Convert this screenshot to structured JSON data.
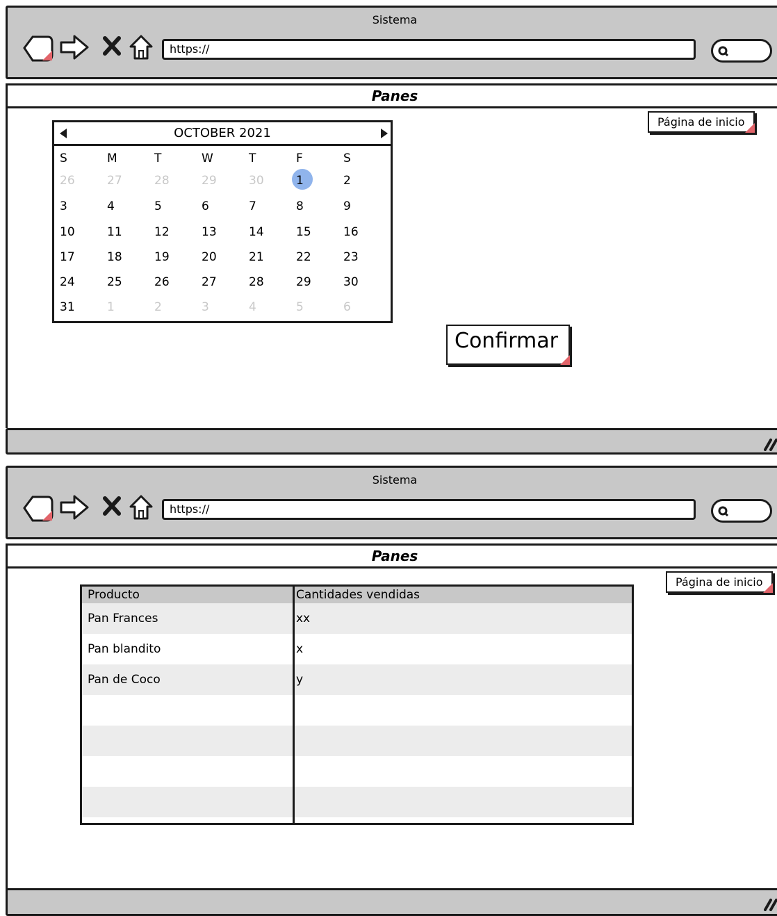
{
  "browser_top": {
    "title": "Sistema",
    "url": "https://",
    "page_title": "Panes",
    "home_button": "Página de inicio"
  },
  "calendar": {
    "month_label": "OCTOBER 2021",
    "weekdays": [
      "S",
      "M",
      "T",
      "W",
      "T",
      "F",
      "S"
    ],
    "weeks": [
      [
        "26",
        "27",
        "28",
        "29",
        "30",
        "1",
        "2"
      ],
      [
        "3",
        "4",
        "5",
        "6",
        "7",
        "8",
        "9"
      ],
      [
        "10",
        "11",
        "12",
        "13",
        "14",
        "15",
        "16"
      ],
      [
        "17",
        "18",
        "19",
        "20",
        "21",
        "22",
        "23"
      ],
      [
        "24",
        "25",
        "26",
        "27",
        "28",
        "29",
        "30"
      ],
      [
        "31",
        "1",
        "2",
        "3",
        "4",
        "5",
        "6"
      ]
    ],
    "selected_day": "1"
  },
  "confirm_label": "Confirmar",
  "browser_bottom": {
    "title": "Sistema",
    "url": "https://",
    "page_title": "Panes",
    "home_button": "Página de inicio"
  },
  "sales_table": {
    "headers": [
      "Producto",
      "Cantidades vendidas"
    ],
    "rows": [
      [
        "Pan Frances",
        "xx"
      ],
      [
        "Pan blandito",
        "x"
      ],
      [
        "Pan de Coco",
        "y"
      ],
      [
        "",
        ""
      ],
      [
        "",
        ""
      ],
      [
        "",
        ""
      ],
      [
        "",
        ""
      ]
    ]
  },
  "colors": {
    "chrome_gray": "#c8c8c8",
    "selected_day": "#90b4ec",
    "corner_marker": "#e2646a",
    "stripe": "#ececec"
  }
}
